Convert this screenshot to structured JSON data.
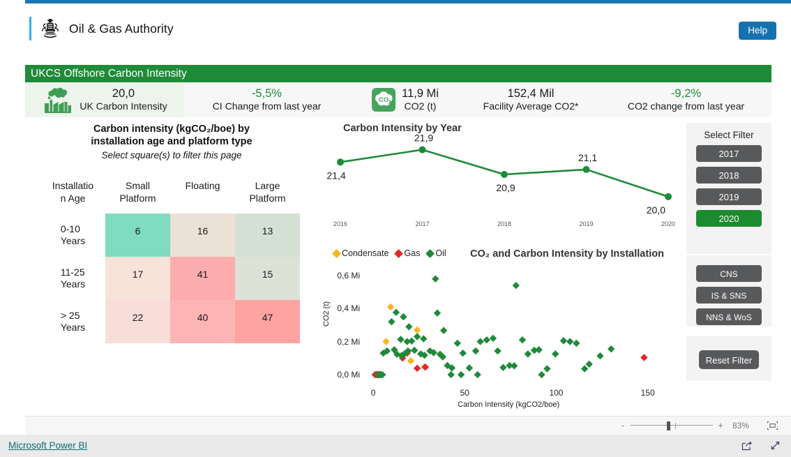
{
  "header": {
    "brand_title": "Oil & Gas Authority",
    "crest_icon": "royal-coat-of-arms-icon",
    "help_label": "Help"
  },
  "report": {
    "title": "UKCS Offshore Carbon Intensity"
  },
  "kpis": [
    {
      "icon": "factory-emissions-icon",
      "value": "20,0",
      "label": "UK Carbon Intensity",
      "value_color": "#1a1a1a"
    },
    {
      "icon": "",
      "value": "-5,5%",
      "label": "CI Change from last year",
      "value_color": "#1f8a38"
    },
    {
      "icon": "co2-cloud-icon",
      "value": "11,9 Mi",
      "label": "CO2 (t)",
      "value_color": "#1a1a1a"
    },
    {
      "icon": "",
      "value": "152,4 Mil",
      "label": "Facility Average CO2*",
      "value_color": "#1a1a1a"
    },
    {
      "icon": "",
      "value": "-9,2%",
      "label": "CO2 change from last year",
      "value_color": "#1f8a38"
    }
  ],
  "heatmap": {
    "title_line1": "Carbon intensity (kgCO₂/boe) by",
    "title_line2": "installation age and platform type",
    "subtitle": "Select square(s) to filter this page",
    "row_header_line1": "Installatio",
    "row_header_line2": "n Age",
    "columns": [
      "Small Platform",
      "Floating",
      "Large Platform"
    ],
    "columns_split": [
      [
        "Small",
        "Platform"
      ],
      [
        "Floating",
        ""
      ],
      [
        "Large",
        "Platform"
      ]
    ],
    "rows": [
      {
        "label_line1": "0-10",
        "label_line2": "Years",
        "cells": [
          {
            "value": "6",
            "color": "#7fdcc0"
          },
          {
            "value": "16",
            "color": "#ebe1d6"
          },
          {
            "value": "13",
            "color": "#d3e0d3"
          }
        ]
      },
      {
        "label_line1": "11-25",
        "label_line2": "Years",
        "cells": [
          {
            "value": "17",
            "color": "#f7e3da"
          },
          {
            "value": "41",
            "color": "#fdadad"
          },
          {
            "value": "15",
            "color": "#dde2d7"
          }
        ]
      },
      {
        "label_line1": "> 25",
        "label_line2": "Years",
        "cells": [
          {
            "value": "22",
            "color": "#f8ddd9"
          },
          {
            "value": "40",
            "color": "#fcb4b4"
          },
          {
            "value": "47",
            "color": "#fda3a2"
          }
        ]
      }
    ]
  },
  "chart_data": [
    {
      "type": "line",
      "name": "carbon-intensity-by-year",
      "title": "Carbon Intensity by Year",
      "xlabel": "",
      "ylabel": "",
      "categories": [
        "2016",
        "2017",
        "2018",
        "2019",
        "2020"
      ],
      "values": [
        21.4,
        21.9,
        20.9,
        21.1,
        20.0
      ],
      "data_labels": [
        "21,4",
        "21,9",
        "20,9",
        "21,1",
        "20,0"
      ],
      "ylim": [
        19.6,
        22.2
      ],
      "grid": false,
      "legend": "none",
      "series_color": "#1f8a38"
    },
    {
      "type": "scatter",
      "name": "co2-and-carbon-intensity-by-installation",
      "title": "CO₂ and Carbon Intensity by Installation",
      "xlabel": "Carbon Intensity (kgCO2/boe)",
      "ylabel": "CO2 (t)",
      "xlim": [
        -5,
        165
      ],
      "ylim": [
        0,
        0.66
      ],
      "xticks": [
        0,
        50,
        100,
        150
      ],
      "xtick_labels": [
        "0",
        "50",
        "100",
        "150"
      ],
      "yticks": [
        0.0,
        0.2,
        0.4,
        0.6
      ],
      "ytick_labels": [
        "0,0 Mi",
        "0,2 Mi",
        "0,4 Mi",
        "0,6 Mi"
      ],
      "grid": false,
      "legend": "top-left",
      "series": [
        {
          "name": "Condensate",
          "color": "#f5b61d",
          "points": [
            [
              9.5,
              0.415
            ],
            [
              7.0,
              0.205
            ],
            [
              24.0,
              0.275
            ],
            [
              20.5,
              0.088
            ],
            [
              28.0,
              0.052
            ]
          ]
        },
        {
          "name": "Gas",
          "color": "#e8242a",
          "points": [
            [
              1.0,
              0.004
            ],
            [
              1.6,
              0.004
            ],
            [
              2.2,
              0.006
            ],
            [
              2.8,
              0.004
            ],
            [
              3.4,
              0.006
            ],
            [
              4.0,
              0.004
            ],
            [
              18.5,
              0.135
            ],
            [
              16.0,
              0.105
            ],
            [
              24.0,
              0.043
            ],
            [
              28.5,
              0.05
            ],
            [
              148.0,
              0.108
            ]
          ]
        },
        {
          "name": "Oil",
          "color": "#1f8a38",
          "points": [
            [
              34.0,
              0.585
            ],
            [
              78.0,
              0.545
            ],
            [
              12.5,
              0.382
            ],
            [
              10.0,
              0.325
            ],
            [
              16.5,
              0.355
            ],
            [
              19.5,
              0.295
            ],
            [
              35.0,
              0.378
            ],
            [
              38.5,
              0.272
            ],
            [
              24.0,
              0.235
            ],
            [
              27.5,
              0.222
            ],
            [
              15.0,
              0.218
            ],
            [
              18.5,
              0.205
            ],
            [
              21.0,
              0.208
            ],
            [
              7.5,
              0.148
            ],
            [
              5.5,
              0.135
            ],
            [
              11.5,
              0.155
            ],
            [
              13.0,
              0.128
            ],
            [
              15.5,
              0.12
            ],
            [
              17.0,
              0.13
            ],
            [
              19.0,
              0.148
            ],
            [
              22.5,
              0.152
            ],
            [
              26.0,
              0.13
            ],
            [
              28.0,
              0.122
            ],
            [
              31.0,
              0.148
            ],
            [
              33.0,
              0.138
            ],
            [
              36.5,
              0.128
            ],
            [
              38.0,
              0.112
            ],
            [
              40.5,
              0.06
            ],
            [
              43.0,
              0.045
            ],
            [
              46.0,
              0.195
            ],
            [
              49.0,
              0.135
            ],
            [
              52.5,
              0.045
            ],
            [
              56.0,
              0.148
            ],
            [
              58.5,
              0.205
            ],
            [
              62.0,
              0.215
            ],
            [
              65.5,
              0.225
            ],
            [
              68.0,
              0.148
            ],
            [
              71.0,
              0.048
            ],
            [
              74.5,
              0.06
            ],
            [
              77.0,
              0.058
            ],
            [
              81.5,
              0.215
            ],
            [
              84.5,
              0.13
            ],
            [
              88.0,
              0.152
            ],
            [
              90.5,
              0.155
            ],
            [
              95.0,
              0.04
            ],
            [
              99.5,
              0.13
            ],
            [
              104.0,
              0.21
            ],
            [
              107.5,
              0.205
            ],
            [
              111.0,
              0.195
            ],
            [
              115.5,
              0.04
            ],
            [
              118.0,
              0.068
            ],
            [
              124.0,
              0.118
            ],
            [
              130.0,
              0.16
            ],
            [
              2.5,
              0.003
            ],
            [
              3.2,
              0.003
            ],
            [
              4.2,
              0.004
            ],
            [
              5.0,
              0.004
            ],
            [
              42.5,
              0.004
            ],
            [
              48.0,
              0.004
            ],
            [
              57.0,
              0.004
            ],
            [
              92.0,
              0.004
            ]
          ]
        }
      ]
    }
  ],
  "filters": {
    "title": "Select Filter",
    "years": [
      {
        "label": "2017",
        "selected": false
      },
      {
        "label": "2018",
        "selected": false
      },
      {
        "label": "2019",
        "selected": false
      },
      {
        "label": "2020",
        "selected": true
      }
    ],
    "regions": [
      {
        "label": "CNS",
        "selected": false
      },
      {
        "label": "IS & SNS",
        "selected": false
      },
      {
        "label": "NNS & WoS",
        "selected": false
      }
    ],
    "reset_label": "Reset Filter"
  },
  "statusbar": {
    "zoom_out": "-",
    "zoom_in": "+",
    "zoom_percent": "83%",
    "fit_icon": "fit-to-page-icon"
  },
  "footer": {
    "powerbi_link": "Microsoft Power BI",
    "share_icon": "share-icon",
    "fullscreen_icon": "fullscreen-icon"
  }
}
